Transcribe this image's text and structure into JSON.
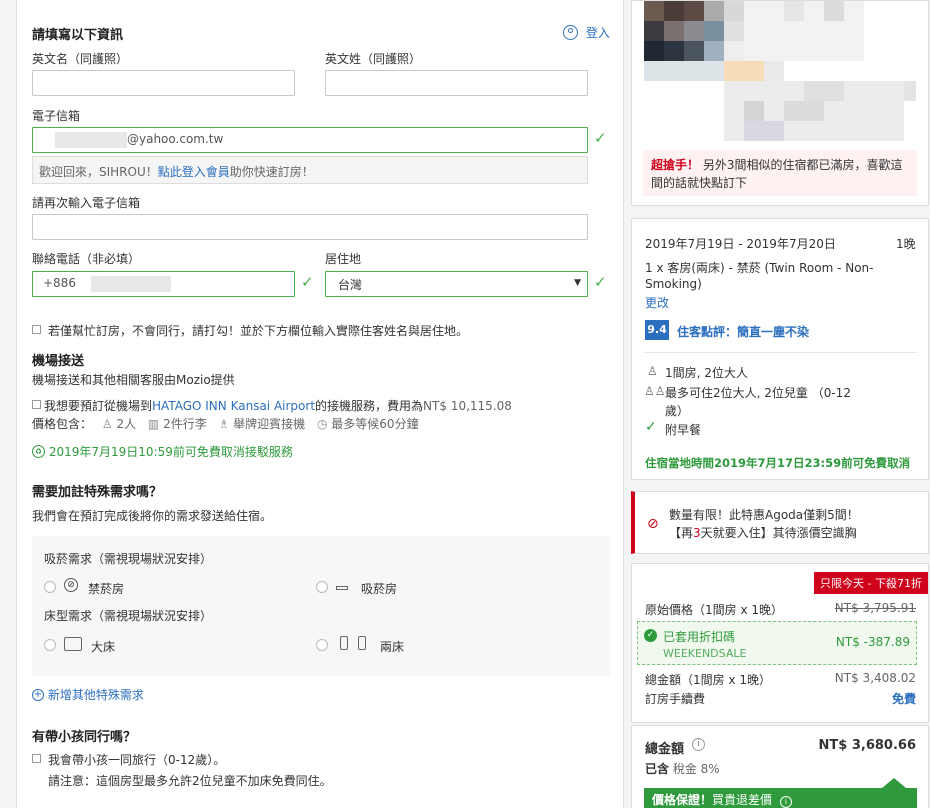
{
  "form": {
    "title": "請填寫以下資訊",
    "login_label": "登入",
    "first_name_label": "英文名（同護照）",
    "last_name_label": "英文姓（同護照）",
    "email_label": "電子信箱",
    "email_value": "@yahoo.com.tw",
    "welcome_prefix": "歡迎回來，SIHROU！",
    "welcome_link": "點此登入會員",
    "welcome_suffix": "助你快速訂房！",
    "email_confirm_label": "請再次輸入電子信箱",
    "phone_label": "聯絡電話（非必填）",
    "phone_prefix": "+886",
    "residence_label": "居住地",
    "residence_value": "台灣",
    "booking_for_other": "若僅幫忙訂房，不會同行，請打勾！並於下方欄位輸入實際住客姓名與居住地。"
  },
  "airport": {
    "title": "機場接送",
    "provider_note": "機場接送和其他相關客服由Mozio提供",
    "option_prefix": "我想要預訂從機場到",
    "option_place": "HATAGO INN Kansai Airport",
    "option_mid": "的接機服務，費用為",
    "option_price": "NT$ 10,115.08",
    "includes_label": "價格包含：",
    "inc_people": "2人",
    "inc_luggage": "2件行李",
    "inc_sign": "舉牌迎賓接機",
    "inc_wait": "最多等候60分鐘",
    "free_cancel": "2019年7月19日10:59前可免費取消接駁服務"
  },
  "special": {
    "title": "需要加註特殊需求嗎？",
    "note": "我們會在預訂完成後將你的需求發送給住宿。",
    "smoking_label": "吸菸需求（需視現場狀況安排）",
    "non_smoking": "禁菸房",
    "smoking": "吸菸房",
    "bed_label": "床型需求（需視現場狀況安排）",
    "double_bed": "大床",
    "twin_bed": "兩床",
    "add_more": "新增其他特殊需求"
  },
  "children": {
    "title": "有帶小孩同行嗎？",
    "option": "我會帶小孩一同旅行（0-12歲）。",
    "note": "請注意：這個房型最多允許2位兒童不加床免費同住。"
  },
  "sidebar": {
    "hot_label": "超搶手！",
    "hot_text_1": "另外3間相似的住宿都已滿房，喜歡這",
    "hot_text_2": "間的話就快點訂下",
    "dates": "2019年7月19日 - 2019年7月20日",
    "nights": "1晚",
    "room_line_1": "1 x 客房(兩床) - 禁菸 (Twin Room - Non-",
    "room_line_2": "Smoking)",
    "change": "更改",
    "score": "9.4",
    "review": "住客點評：簡直一塵不染",
    "occupancy": "1間房, 2位大人",
    "capacity_1": "最多可住2位大人, 2位兒童 （0-12",
    "capacity_2": "歲）",
    "breakfast": "附早餐",
    "cancel_policy": "住宿當地時間2019年7月17日23:59前可免費取消",
    "limited_1": "數量有限！此特惠Agoda僅剩5間！",
    "limited_2_pre": "【再",
    "limited_2_num": "3",
    "limited_2_post": "天就要入住】其待漲價空識胸",
    "today_badge": "只限今天 - 下殺71折",
    "orig_label": "原始價格（1間房 x 1晚）",
    "orig_price": "NT$ 3,795.91",
    "coupon_label": "已套用折扣碼",
    "coupon_code": "WEEKENDSALE",
    "coupon_value": "NT$ -387.89",
    "subtotal_label": "總金額（1間房 x 1晚）",
    "subtotal_value": "NT$ 3,408.02",
    "fee_label": "訂房手續費",
    "fee_value": "免費",
    "total_label": "總金額",
    "total_value": "NT$ 3,680.66",
    "tax_note_pre": "已含",
    "tax_note_post": "稅金 8%",
    "guarantee_pre": "價格保證！",
    "guarantee_post": "買貴退差價"
  },
  "colors": {
    "green": "#2e9a3b",
    "blue": "#2c6fbf",
    "red": "#d0021b",
    "score_bg": "#2c6fbf"
  }
}
